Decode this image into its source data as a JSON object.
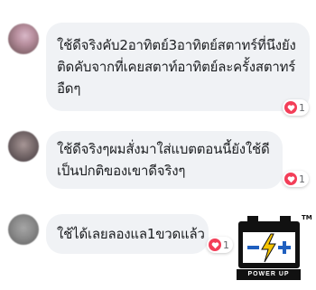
{
  "comments": [
    {
      "lines": [
        "ใช้ดีจริงคับ2อาทิตย์3อาทิตย์สตาทร์ที่นึงยัง",
        "ติดคับจากที่เคยสตาท์อาทิตย์ละครั้งสตาทร์",
        "อืดๆ"
      ],
      "reaction_count": "1"
    },
    {
      "lines": [
        "ใช้ดีจริงๆผมสั่งมาใส่แบตตอนนี้ยังใช้ดี",
        "เป็นปกติของเขาดีจริงๆ"
      ],
      "reaction_count": "1"
    },
    {
      "lines": [
        "ใช้ได้เลยลองแล1ขวดแล้ว"
      ],
      "reaction_count": "1"
    }
  ],
  "logo": {
    "badge_text": "POWER UP",
    "trademark": "TM"
  },
  "colors": {
    "bubble": "#f0f2f5",
    "reaction_heart": "#f33e58",
    "logo_blue": "#1f5fbf",
    "logo_yellow": "#f5c400"
  }
}
